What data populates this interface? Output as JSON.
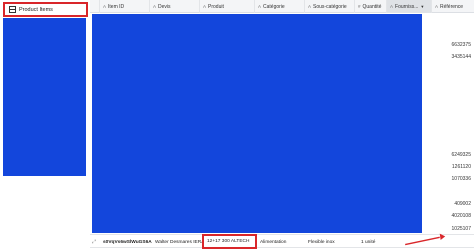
{
  "sidebar": {
    "tab_label": "Product Items"
  },
  "table": {
    "columns": [
      {
        "type": "A",
        "label": "Item ID"
      },
      {
        "type": "A",
        "label": "Devis"
      },
      {
        "type": "A",
        "label": "Produit"
      },
      {
        "type": "A",
        "label": "Catégorie"
      },
      {
        "type": "A",
        "label": "Sous-catégorie"
      },
      {
        "type": "#",
        "label": "Quantité"
      },
      {
        "type": "A",
        "label": "Fourniss..."
      },
      {
        "type": "A",
        "label": "Référence"
      }
    ],
    "reference_values": [
      "6632375",
      "3435144",
      "6249325",
      "1261120",
      "1070336",
      "409002",
      "4020108",
      "1025107"
    ],
    "selected_row": {
      "item_id": "s0VqVs6wSlWuGS6A",
      "devis": "Walter Desmares IERA",
      "produit": "12+17 300 ALTECH",
      "categorie": "Alimentation",
      "sous_categorie": "Flexible inox",
      "quantite": "1 unité"
    }
  },
  "colors": {
    "overlay_blue": "#1346dc",
    "highlight_red": "#d9262a"
  }
}
